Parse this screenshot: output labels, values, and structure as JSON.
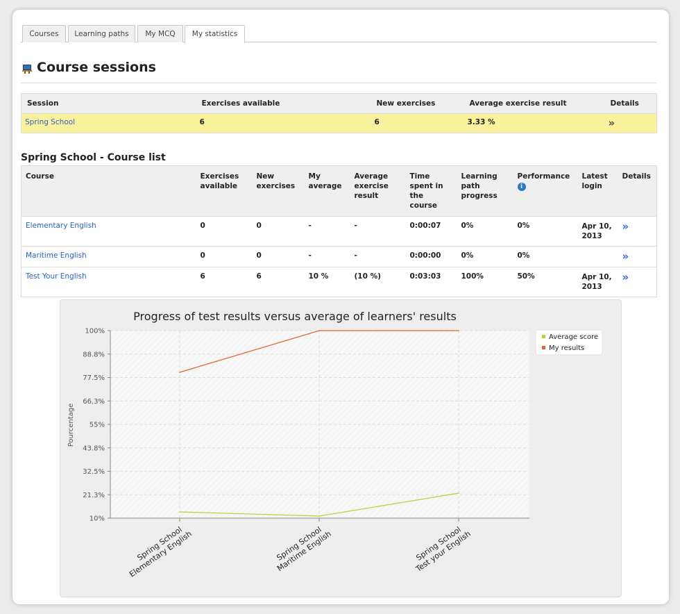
{
  "tabs": [
    {
      "label": "Courses"
    },
    {
      "label": "Learning paths"
    },
    {
      "label": "My MCQ"
    },
    {
      "label": "My statistics"
    }
  ],
  "page_title": "Course sessions",
  "sessions": {
    "headers": [
      "Session",
      "Exercises available",
      "New exercises",
      "Average exercise result",
      "Details"
    ],
    "rows": [
      {
        "session": "Spring School",
        "exercises_available": "6",
        "new_exercises": "6",
        "average_result": "3.33 %"
      }
    ]
  },
  "course_list": {
    "title": "Spring School - Course list",
    "headers": [
      "Course",
      "Exercises available",
      "New exercises",
      "My average",
      "Average exercise result",
      "Time spent in the course",
      "Learning path progress",
      "Performance",
      "Latest login",
      "Details"
    ],
    "rows": [
      {
        "course": "Elementary English",
        "exercises_available": "0",
        "new_exercises": "0",
        "my_average": "-",
        "average_result": "-",
        "time_spent": "0:00:07",
        "lp_progress": "0%",
        "performance": "0%",
        "latest_login": "Apr 10, 2013"
      },
      {
        "course": "Maritime English",
        "exercises_available": "0",
        "new_exercises": "0",
        "my_average": "-",
        "average_result": "-",
        "time_spent": "0:00:00",
        "lp_progress": "0%",
        "performance": "0%",
        "latest_login": ""
      },
      {
        "course": "Test Your English",
        "exercises_available": "6",
        "new_exercises": "6",
        "my_average": "10 %",
        "average_result": "(10 %)",
        "time_spent": "0:03:03",
        "lp_progress": "100%",
        "performance": "50%",
        "latest_login": "Apr 10, 2013"
      }
    ]
  },
  "chart_data": {
    "type": "line",
    "title": "Progress of test results versus average of learners' results",
    "ylabel": "Pourcentage",
    "xlabel": "",
    "ylim": [
      10,
      100
    ],
    "yticks": [
      "10%",
      "21.3%",
      "32.5%",
      "43.8%",
      "55%",
      "66.3%",
      "77.5%",
      "88.8%",
      "100%"
    ],
    "categories": [
      [
        "Spring School",
        "Elementary English"
      ],
      [
        "Spring School",
        "Maritime English"
      ],
      [
        "Spring School",
        "Test your English"
      ]
    ],
    "series": [
      {
        "name": "Average score",
        "color": "#b5d334",
        "values": [
          13,
          11,
          22
        ]
      },
      {
        "name": "My results",
        "color": "#e0622f",
        "values": [
          80,
          100,
          100
        ]
      }
    ],
    "grid": true,
    "legend_position": "top-right"
  }
}
